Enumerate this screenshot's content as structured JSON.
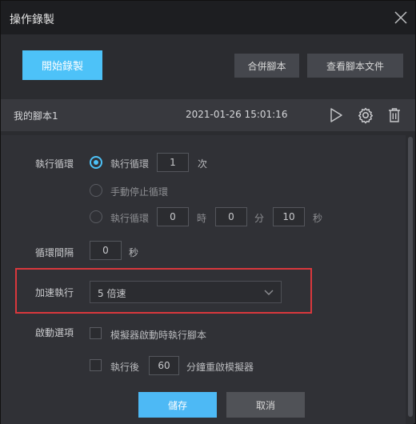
{
  "window": {
    "title": "操作錄製"
  },
  "toolbar": {
    "record_label": "開始錄製",
    "merge_label": "合併腳本",
    "view_label": "查看腳本文件"
  },
  "script": {
    "name": "我的腳本1",
    "timestamp": "2021-01-26 15:01:16"
  },
  "settings": {
    "loop": {
      "label": "執行循環",
      "option1": {
        "text": "執行循環",
        "count": "1",
        "unit": "次",
        "checked": true
      },
      "option2": {
        "text": "手動停止循環",
        "checked": false
      },
      "option3": {
        "text": "執行循環",
        "hours": "0",
        "hours_unit": "時",
        "minutes": "0",
        "minutes_unit": "分",
        "seconds": "10",
        "seconds_unit": "秒",
        "checked": false
      }
    },
    "interval": {
      "label": "循環間隔",
      "value": "0",
      "unit": "秒"
    },
    "speed": {
      "label": "加速執行",
      "selected": "5 倍速"
    },
    "startup": {
      "label": "啟動選項",
      "option1_text": "模擬器啟動時執行腳本",
      "option2_prefix": "執行後",
      "option2_value": "60",
      "option2_suffix": "分鐘重啟模擬器"
    }
  },
  "footer": {
    "save_label": "儲存",
    "cancel_label": "取消"
  },
  "colors": {
    "accent": "#4dc2f8",
    "highlight": "#d9383d",
    "background": "#2b2c30"
  }
}
